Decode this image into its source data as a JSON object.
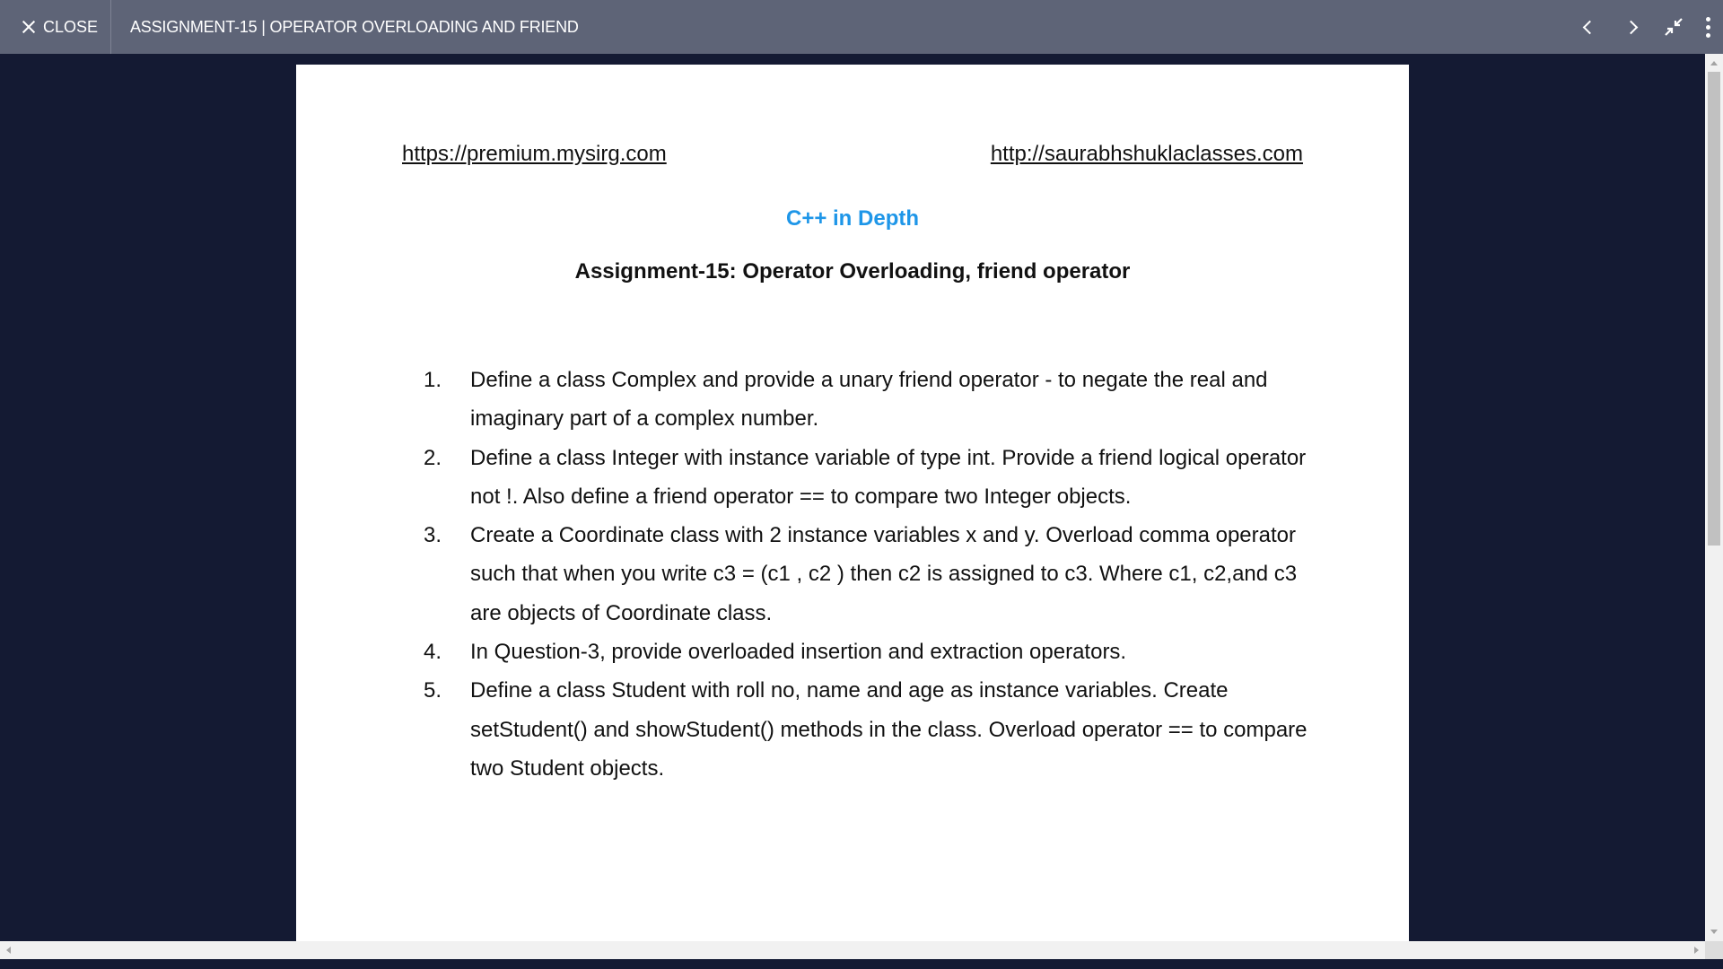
{
  "topbar": {
    "close_label": "CLOSE",
    "title": "ASSIGNMENT-15 | OPERATOR OVERLOADING AND FRIEND",
    "icons": [
      "close-icon",
      "chevron-left-icon",
      "chevron-right-icon",
      "collapse-icon",
      "more-vertical-icon"
    ]
  },
  "document": {
    "link_left": "https://premium.mysirg.com",
    "link_right": "http://saurabhshuklaclasses.com",
    "course_title": "C++ in Depth",
    "assignment_title": "Assignment-15: Operator Overloading, friend operator",
    "questions": [
      {
        "num": "1.",
        "text": "Define a class Complex and provide a unary friend operator - to negate the real and imaginary part of a complex number."
      },
      {
        "num": "2.",
        "text": "Define a class Integer with instance variable of type int. Provide a friend logical operator not !. Also define a friend operator == to compare two Integer objects."
      },
      {
        "num": "3.",
        "text": "Create a Coordinate class with 2 instance variables x and y. Overload comma operator such that when you write  c3 = (c1 , c2 ) then c2 is assigned to c3. Where c1, c2,and c3 are objects of Coordinate class."
      },
      {
        "num": "4.",
        "text": "In Question-3, provide overloaded insertion and extraction operators."
      },
      {
        "num": "5.",
        "text": "Define a class Student with roll no, name and age as instance variables. Create setStudent() and showStudent() methods in the class. Overload operator == to compare two Student objects."
      }
    ]
  },
  "colors": {
    "topbar_bg": "#5e6477",
    "viewer_bg": "#141a33",
    "course_title": "#1e96e8"
  }
}
